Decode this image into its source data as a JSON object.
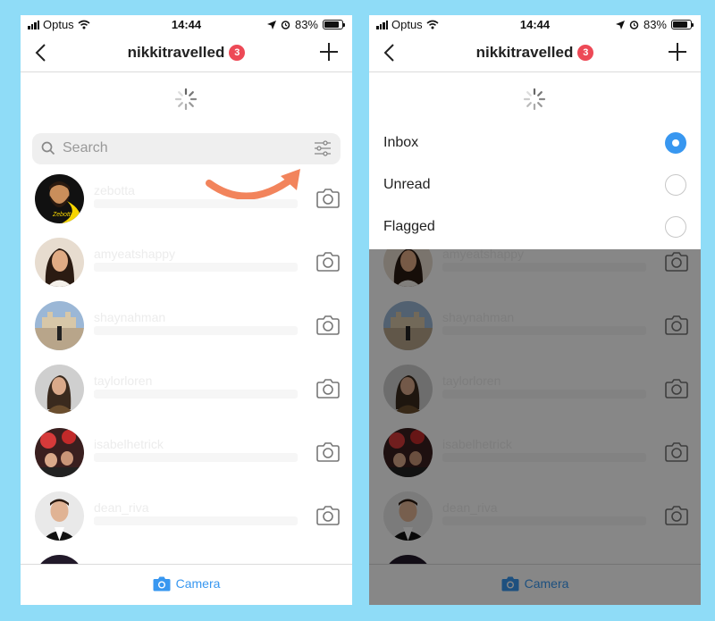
{
  "colors": {
    "background": "#8fdcf7",
    "accent": "#3897f0",
    "badge": "#ed4956",
    "arrow": "#f2845c"
  },
  "status": {
    "carrier": "Optus",
    "time": "14:44",
    "battery": "83%",
    "battery_level": 0.83
  },
  "header": {
    "title": "nikkitravelled",
    "badge_count": "3"
  },
  "search": {
    "placeholder": "Search"
  },
  "threads": [
    {
      "name": "zebotta",
      "avatar_text": "Zebotta"
    },
    {
      "name": "amyeatshappy"
    },
    {
      "name": "shaynahman"
    },
    {
      "name": "taylorloren"
    },
    {
      "name": "isabelhetrick"
    },
    {
      "name": "dean_riva"
    }
  ],
  "filter_options": [
    {
      "label": "Inbox",
      "selected": true
    },
    {
      "label": "Unread",
      "selected": false
    },
    {
      "label": "Flagged",
      "selected": false
    }
  ],
  "footer": {
    "camera_label": "Camera"
  }
}
